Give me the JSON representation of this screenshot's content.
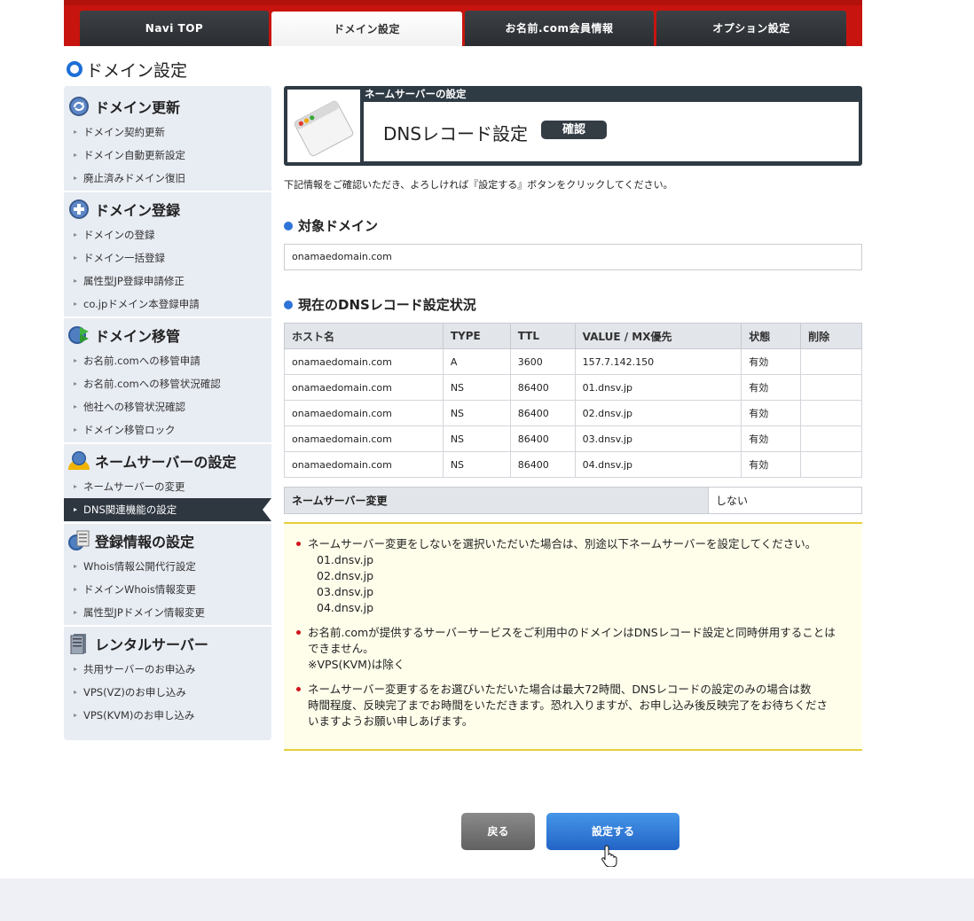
{
  "nav": {
    "tabs": [
      {
        "label": "Navi TOP"
      },
      {
        "label": "ドメイン設定"
      },
      {
        "label": "お名前.com会員情報"
      },
      {
        "label": "オプション設定"
      }
    ]
  },
  "page_title": "ドメイン設定",
  "sidebar": {
    "sections": [
      {
        "title": "ドメイン更新",
        "icon": "refresh-icon",
        "items": [
          "ドメイン契約更新",
          "ドメイン自動更新設定",
          "廃止済みドメイン復旧"
        ]
      },
      {
        "title": "ドメイン登録",
        "icon": "plus-icon",
        "items": [
          "ドメインの登録",
          "ドメイン一括登録",
          "属性型JP登録申請修正",
          "co.jpドメイン本登録申請"
        ]
      },
      {
        "title": "ドメイン移管",
        "icon": "transfer-icon",
        "items": [
          "お名前.comへの移管申請",
          "お名前.comへの移管状況確認",
          "他社への移管状況確認",
          "ドメイン移管ロック"
        ]
      },
      {
        "title": "ネームサーバーの設定",
        "icon": "nameserver-icon",
        "items": [
          "ネームサーバーの変更",
          "DNS関連機能の設定"
        ]
      },
      {
        "title": "登録情報の設定",
        "icon": "registration-info-icon",
        "items": [
          "Whois情報公開代行設定",
          "ドメインWhois情報変更",
          "属性型JPドメイン情報変更"
        ]
      },
      {
        "title": "レンタルサーバー",
        "icon": "server-icon",
        "items": [
          "共用サーバーのお申込み",
          "VPS(VZ)のお申し込み",
          "VPS(KVM)のお申し込み"
        ]
      }
    ],
    "active_item": "DNS関連機能の設定"
  },
  "header": {
    "small_title": "ネームサーバーの設定",
    "big_title": "DNSレコード設定",
    "badge": "確認"
  },
  "instruction": "下記情報をご確認いただき、よろしければ『設定する』ボタンをクリックしてください。",
  "target_domain": {
    "heading": "対象ドメイン",
    "value": "onamaedomain.com"
  },
  "dns_status": {
    "heading": "現在のDNSレコード設定状況",
    "columns": [
      "ホスト名",
      "TYPE",
      "TTL",
      "VALUE / MX優先",
      "状態",
      "削除"
    ],
    "rows": [
      [
        "onamaedomain.com",
        "A",
        "3600",
        "157.7.142.150",
        "有効",
        ""
      ],
      [
        "onamaedomain.com",
        "NS",
        "86400",
        "01.dnsv.jp",
        "有効",
        ""
      ],
      [
        "onamaedomain.com",
        "NS",
        "86400",
        "02.dnsv.jp",
        "有効",
        ""
      ],
      [
        "onamaedomain.com",
        "NS",
        "86400",
        "03.dnsv.jp",
        "有効",
        ""
      ],
      [
        "onamaedomain.com",
        "NS",
        "86400",
        "04.dnsv.jp",
        "有効",
        ""
      ]
    ]
  },
  "nameserver_change": {
    "label": "ネームサーバー変更",
    "value": "しない"
  },
  "notice": {
    "note1": "ネームサーバー変更をしないを選択いただいた場合は、別途以下ネームサーバーを設定してください。",
    "nameservers": [
      "01.dnsv.jp",
      "02.dnsv.jp",
      "03.dnsv.jp",
      "04.dnsv.jp"
    ],
    "note2_line1": "お名前.comが提供するサーバーサービスをご利用中のドメインはDNSレコード設定と同時併用することは",
    "note2_line2": "できません。",
    "note2_line3": "※VPS(KVM)は除く",
    "note3_line1": "ネームサーバー変更するをお選びいただいた場合は最大72時間、DNSレコードの設定のみの場合は数",
    "note3_line2": "時間程度、反映完了までお時間をいただきます。恐れ入りますが、お申し込み後反映完了をお待ちくださ",
    "note3_line3": "いますようお願い申しあげます。"
  },
  "buttons": {
    "back": "戻る",
    "submit": "設定する"
  },
  "colors": {
    "brand_red": "#c8140e",
    "nav_dark": "#2a2d31",
    "accent_blue": "#2e74d8",
    "notice_bg": "#fffeeb",
    "notice_border": "#e7cf3c"
  }
}
